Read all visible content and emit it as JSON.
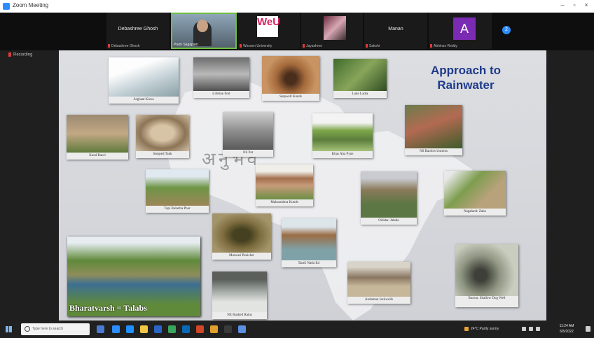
{
  "window": {
    "title": "Zoom Meeting",
    "minimize": "–",
    "maximize": "▫",
    "close": "×"
  },
  "participants": [
    {
      "id": "p1",
      "big_name": "Debashree Ghosh",
      "caption": "Debashree Ghosh"
    },
    {
      "id": "p2",
      "caption": "Prem Sagapam"
    },
    {
      "id": "p3",
      "caption": "Woxsen University",
      "logo_text": "WeU"
    },
    {
      "id": "p4",
      "caption": "Jayashree"
    },
    {
      "id": "p5",
      "big_name": "Manan",
      "caption": "Sakshi"
    },
    {
      "id": "p6",
      "caption": "Abhinav Reddy",
      "avatar_letter": "A"
    }
  ],
  "more_button": "2",
  "speaking_label": "Recording",
  "slide": {
    "title_line1": "Approach to",
    "title_line2": "Rainwater",
    "watermark": "अनुभव",
    "big_card_label": "Bharatvarsh = Talabs",
    "cards": [
      "Arghaat Kuwa",
      "Lifeline Fort",
      "Stepwell Kunds",
      "Lake Ladia",
      "Kund Baori",
      "Stepped Tank",
      "Nil Pat",
      "Khas Aha Pyne",
      "Nil Baolow/cisterns",
      "Maharashtra Kunds",
      "Tapi Buhetha Phar",
      "Odisha: Jalado",
      "Nagaland: Zabo",
      "Marwari Panicher",
      "Tamil Nadu Eri",
      "Andaman Jackwells",
      "Burma: Shallow Dug Well",
      "NE Rushed Rains"
    ]
  },
  "taskbar": {
    "search_placeholder": "Type here to search",
    "weather": "24°C  Partly sunny",
    "time": "11:24 AM",
    "date": "6/5/2022"
  },
  "colors": {
    "title_blue": "#1f3a8a",
    "zoom_blue": "#2d8cff",
    "avatar_purple": "#7b2ab3",
    "active_green": "#6fbf3f"
  },
  "icons": [
    "zoom-app-icon",
    "microphone-muted-icon",
    "search-icon",
    "windows-start-icon",
    "wifi-icon",
    "volume-icon",
    "battery-icon"
  ]
}
